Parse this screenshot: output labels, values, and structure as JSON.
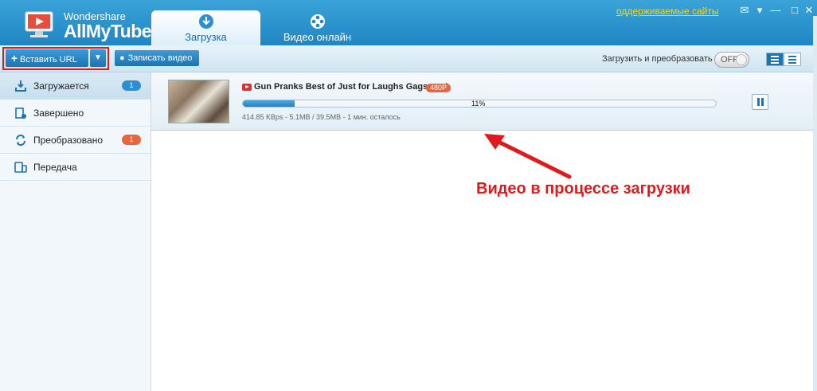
{
  "app": {
    "brand_small": "Wondershare",
    "brand_big": "AllMyTube",
    "supported_sites_link": "оддерживаемые сайты"
  },
  "tabs": [
    {
      "label": "Загрузка",
      "icon": "download-circle-icon",
      "active": true
    },
    {
      "label": "Видео онлайн",
      "icon": "film-reel-icon",
      "active": false
    }
  ],
  "toolbar": {
    "paste_url_label": "Вставить URL",
    "record_video_label": "Записать видео",
    "convert_label": "Загрузить и преобразовать",
    "toggle_state": "OFF"
  },
  "sidebar": {
    "items": [
      {
        "label": "Загружается",
        "icon": "download-tray-icon",
        "badge": "1",
        "badge_color": "#2b8fd2"
      },
      {
        "label": "Завершено",
        "icon": "completed-list-icon",
        "badge": "",
        "badge_color": ""
      },
      {
        "label": "Преобразовано",
        "icon": "convert-arrows-icon",
        "badge": "1",
        "badge_color": "#e8663c"
      },
      {
        "label": "Передача",
        "icon": "transfer-devices-icon",
        "badge": "",
        "badge_color": ""
      }
    ]
  },
  "download": {
    "file_name": "Gun Pranks  Best of Just for Laughs Gags.mp4",
    "quality": "480P",
    "progress_percent": 11,
    "progress_text": "11%",
    "speed_info": "414.85 KBps - 5.1MB / 39.5MB - 1 мин. осталось"
  },
  "annotation": {
    "text": "Видео в процессе загрузки",
    "color": "#e0191d"
  },
  "colors": {
    "header_blue": "#1f86c3",
    "accent_blue": "#1c74b3",
    "highlight_red": "#e0191d"
  }
}
